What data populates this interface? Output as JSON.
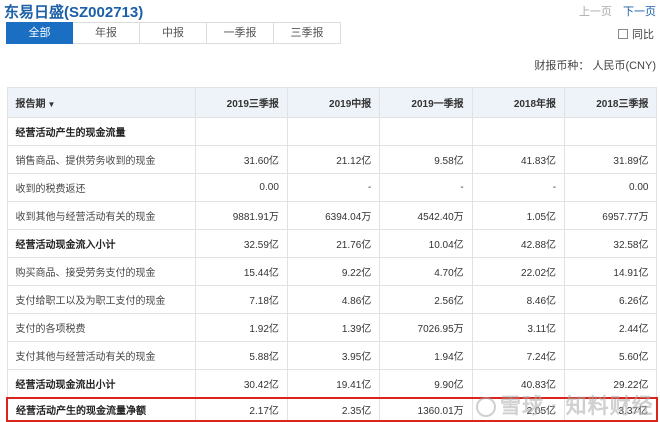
{
  "header": {
    "title": "东易日盛(SZ002713)",
    "prev_label": "上一页",
    "next_label": "下一页"
  },
  "tabs": [
    {
      "label": "全部",
      "active": true
    },
    {
      "label": "年报",
      "active": false
    },
    {
      "label": "中报",
      "active": false
    },
    {
      "label": "一季报",
      "active": false
    },
    {
      "label": "三季报",
      "active": false
    }
  ],
  "yoy_label": "同比",
  "currency_label": "财报币种：  人民币(CNY)",
  "table": {
    "header_label": "报告期",
    "columns": [
      "2019三季报",
      "2019中报",
      "2019一季报",
      "2018年报",
      "2018三季报"
    ],
    "rows": [
      {
        "label": "经营活动产生的现金流量",
        "values": [
          "",
          "",
          "",
          "",
          ""
        ],
        "type": "section"
      },
      {
        "label": "销售商品、提供劳务收到的现金",
        "values": [
          "31.60亿",
          "21.12亿",
          "9.58亿",
          "41.83亿",
          "31.89亿"
        ],
        "type": "normal"
      },
      {
        "label": "收到的税费返还",
        "values": [
          "0.00",
          "-",
          "-",
          "-",
          "0.00"
        ],
        "type": "normal"
      },
      {
        "label": "收到其他与经营活动有关的现金",
        "values": [
          "9881.91万",
          "6394.04万",
          "4542.40万",
          "1.05亿",
          "6957.77万"
        ],
        "type": "normal"
      },
      {
        "label": "经营活动现金流入小计",
        "values": [
          "32.59亿",
          "21.76亿",
          "10.04亿",
          "42.88亿",
          "32.58亿"
        ],
        "type": "bold"
      },
      {
        "label": "购买商品、接受劳务支付的现金",
        "values": [
          "15.44亿",
          "9.22亿",
          "4.70亿",
          "22.02亿",
          "14.91亿"
        ],
        "type": "normal"
      },
      {
        "label": "支付给职工以及为职工支付的现金",
        "values": [
          "7.18亿",
          "4.86亿",
          "2.56亿",
          "8.46亿",
          "6.26亿"
        ],
        "type": "normal"
      },
      {
        "label": "支付的各项税费",
        "values": [
          "1.92亿",
          "1.39亿",
          "7026.95万",
          "3.11亿",
          "2.44亿"
        ],
        "type": "normal"
      },
      {
        "label": "支付其他与经营活动有关的现金",
        "values": [
          "5.88亿",
          "3.95亿",
          "1.94亿",
          "7.24亿",
          "5.60亿"
        ],
        "type": "normal"
      },
      {
        "label": "经营活动现金流出小计",
        "values": [
          "30.42亿",
          "19.41亿",
          "9.90亿",
          "40.83亿",
          "29.22亿"
        ],
        "type": "bold"
      },
      {
        "label": "经营活动产生的现金流量净额",
        "values": [
          "2.17亿",
          "2.35亿",
          "1360.01万",
          "2.05亿",
          "3.37亿"
        ],
        "type": "bold",
        "highlight": true
      }
    ]
  },
  "watermark_text": "雪球 · 知料财经"
}
